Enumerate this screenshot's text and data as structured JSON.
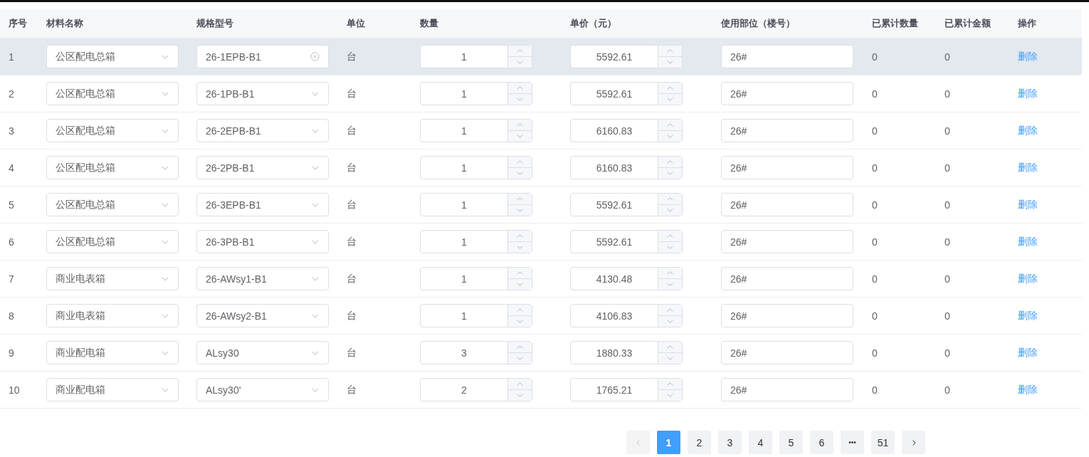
{
  "table": {
    "columns": [
      "序号",
      "材料名称",
      "规格型号",
      "单位",
      "数量",
      "单价（元）",
      "使用部位（楼号）",
      "已累计数量",
      "已累计金额",
      "操作"
    ],
    "rows": [
      {
        "index": "1",
        "material": "公区配电总箱",
        "spec": "26-1EPB-B1",
        "unit": "台",
        "quantity": "1",
        "price": "5592.61",
        "location": "26#",
        "cum_quantity": "0",
        "cum_amount": "0",
        "action": "删除",
        "highlighted": true
      },
      {
        "index": "2",
        "material": "公区配电总箱",
        "spec": "26-1PB-B1",
        "unit": "台",
        "quantity": "1",
        "price": "5592.61",
        "location": "26#",
        "cum_quantity": "0",
        "cum_amount": "0",
        "action": "删除",
        "highlighted": false
      },
      {
        "index": "3",
        "material": "公区配电总箱",
        "spec": "26-2EPB-B1",
        "unit": "台",
        "quantity": "1",
        "price": "6160.83",
        "location": "26#",
        "cum_quantity": "0",
        "cum_amount": "0",
        "action": "删除",
        "highlighted": false
      },
      {
        "index": "4",
        "material": "公区配电总箱",
        "spec": "26-2PB-B1",
        "unit": "台",
        "quantity": "1",
        "price": "6160.83",
        "location": "26#",
        "cum_quantity": "0",
        "cum_amount": "0",
        "action": "删除",
        "highlighted": false
      },
      {
        "index": "5",
        "material": "公区配电总箱",
        "spec": "26-3EPB-B1",
        "unit": "台",
        "quantity": "1",
        "price": "5592.61",
        "location": "26#",
        "cum_quantity": "0",
        "cum_amount": "0",
        "action": "删除",
        "highlighted": false
      },
      {
        "index": "6",
        "material": "公区配电总箱",
        "spec": "26-3PB-B1",
        "unit": "台",
        "quantity": "1",
        "price": "5592.61",
        "location": "26#",
        "cum_quantity": "0",
        "cum_amount": "0",
        "action": "删除",
        "highlighted": false
      },
      {
        "index": "7",
        "material": "商业电表箱",
        "spec": "26-AWsy1-B1",
        "unit": "台",
        "quantity": "1",
        "price": "4130.48",
        "location": "26#",
        "cum_quantity": "0",
        "cum_amount": "0",
        "action": "删除",
        "highlighted": false
      },
      {
        "index": "8",
        "material": "商业电表箱",
        "spec": "26-AWsy2-B1",
        "unit": "台",
        "quantity": "1",
        "price": "4106.83",
        "location": "26#",
        "cum_quantity": "0",
        "cum_amount": "0",
        "action": "删除",
        "highlighted": false
      },
      {
        "index": "9",
        "material": "商业配电箱",
        "spec": "ALsy30",
        "unit": "台",
        "quantity": "3",
        "price": "1880.33",
        "location": "26#",
        "cum_quantity": "0",
        "cum_amount": "0",
        "action": "删除",
        "highlighted": false
      },
      {
        "index": "10",
        "material": "商业配电箱",
        "spec": "ALsy30'",
        "unit": "台",
        "quantity": "2",
        "price": "1765.21",
        "location": "26#",
        "cum_quantity": "0",
        "cum_amount": "0",
        "action": "删除",
        "highlighted": false
      }
    ]
  },
  "pagination": {
    "prev_disabled": true,
    "pages": [
      {
        "label": "1",
        "kind": "page",
        "selected": true
      },
      {
        "label": "2",
        "kind": "page",
        "selected": false
      },
      {
        "label": "3",
        "kind": "page",
        "selected": false
      },
      {
        "label": "4",
        "kind": "page",
        "selected": false
      },
      {
        "label": "5",
        "kind": "page",
        "selected": false
      },
      {
        "label": "6",
        "kind": "page",
        "selected": false
      },
      {
        "label": "•••",
        "kind": "more",
        "selected": false
      },
      {
        "label": "51",
        "kind": "page",
        "selected": false
      }
    ]
  }
}
